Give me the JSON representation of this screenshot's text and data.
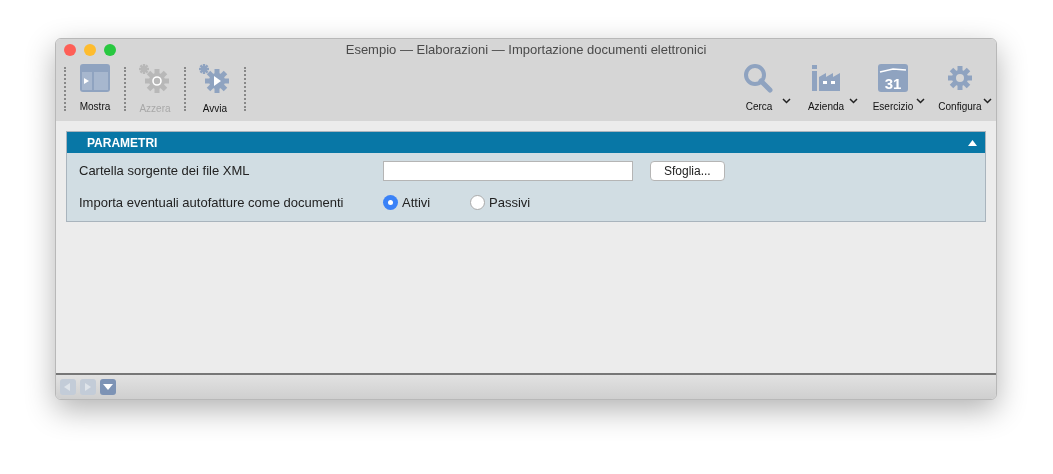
{
  "window": {
    "title": "Esempio — Elaborazioni — Importazione documenti elettronici"
  },
  "toolbar_left": [
    {
      "label": "Mostra",
      "disabled": false
    },
    {
      "label": "Azzera",
      "disabled": true
    },
    {
      "label": "Avvia",
      "disabled": false
    }
  ],
  "toolbar_right": [
    {
      "label": "Cerca",
      "has_menu": true
    },
    {
      "label": "Azienda",
      "has_menu": true
    },
    {
      "label": "Esercizio",
      "has_menu": true,
      "icon_text": "31"
    },
    {
      "label": "Configura",
      "has_menu": true
    }
  ],
  "panel": {
    "title": "PARAMETRI",
    "expanded": true,
    "folder_label": "Cartella sorgente dei file XML",
    "browse_button": "Sfoglia...",
    "import_label": "Importa eventuali autofatture come documenti",
    "options": [
      {
        "label": "Attivi",
        "selected": true
      },
      {
        "label": "Passivi",
        "selected": false
      }
    ]
  },
  "nav_buttons": [
    {
      "kind": "prev",
      "disabled": true
    },
    {
      "kind": "next",
      "disabled": true
    },
    {
      "kind": "down",
      "disabled": false
    }
  ]
}
